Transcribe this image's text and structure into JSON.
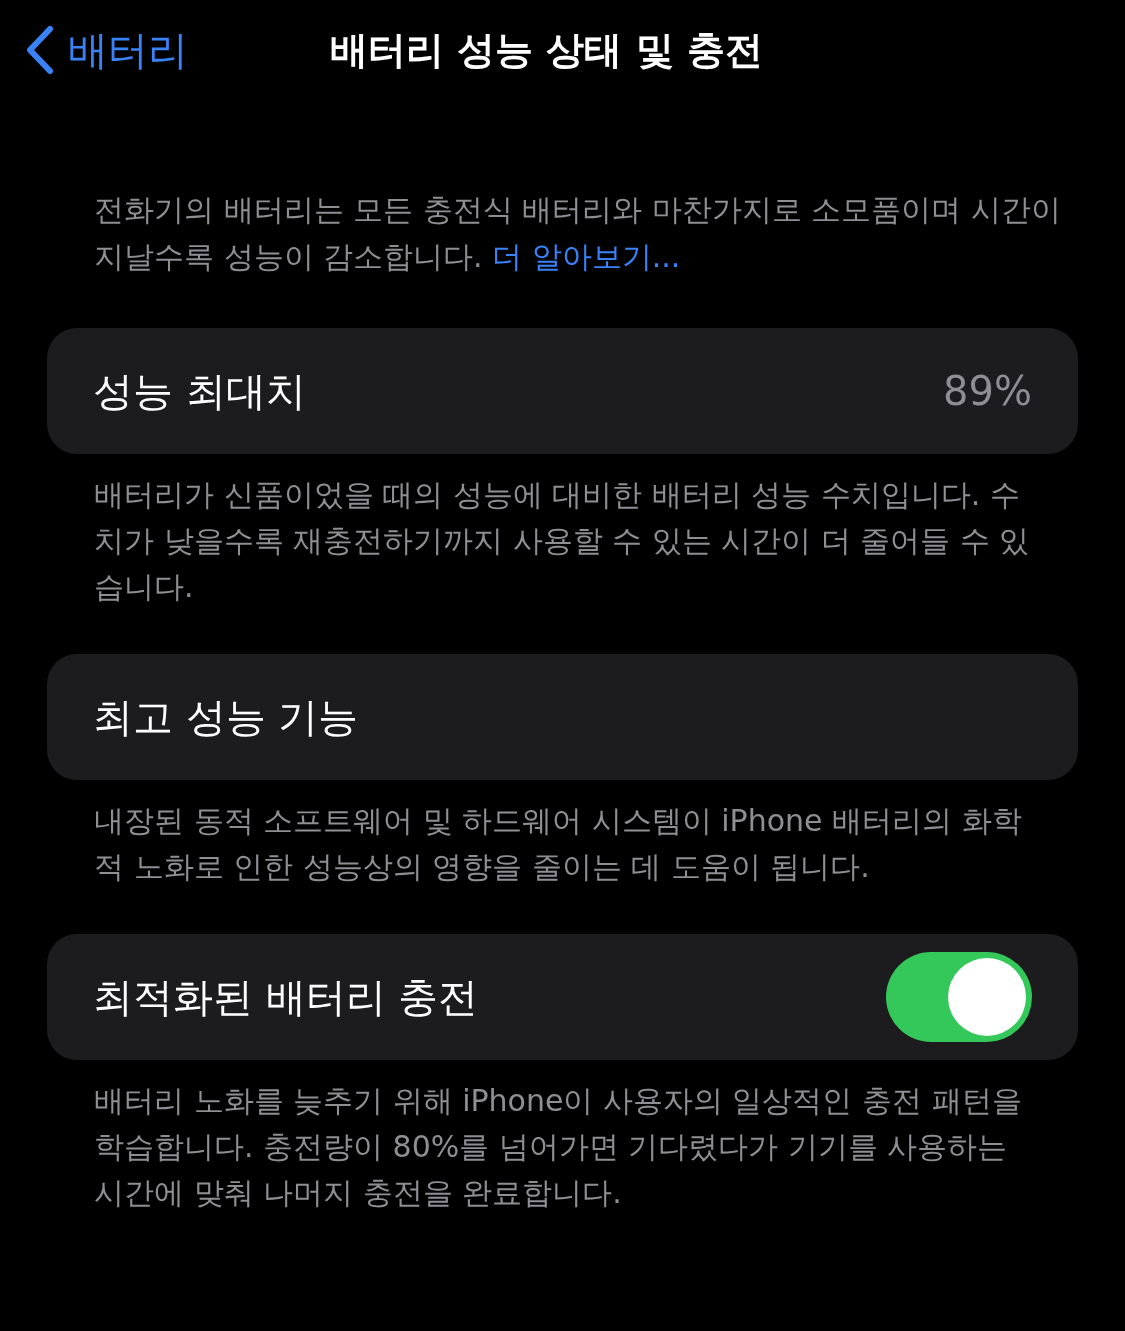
{
  "nav": {
    "back_label": "배터리",
    "title": "배터리 성능 상태 및 충전"
  },
  "intro": {
    "text": "전화기의 배터리는 모든 충전식 배터리와 마찬가지로 소모품이며 시간이 지날수록 성능이 감소합니다.",
    "link": "더 알아보기..."
  },
  "rows": [
    {
      "kind": "value",
      "label": "성능 최대치",
      "value": "89%",
      "footnote": "배터리가 신품이었을 때의 성능에 대비한 배터리 성능 수치입니다. 수치가 낮을수록 재충전하기까지 사용할 수 있는 시간이 더 줄어들 수 있습니다."
    },
    {
      "kind": "plain",
      "label": "최고 성능 기능",
      "footnote": "내장된 동적 소프트웨어 및 하드웨어 시스템이 iPhone 배터리의 화학적 노화로 인한 성능상의 영향을 줄이는 데 도움이 됩니다."
    },
    {
      "kind": "toggle",
      "label": "최적화된 배터리 충전",
      "on": true,
      "footnote": "배터리 노화를 늦추기 위해 iPhone이 사용자의 일상적인 충전 패턴을 학습합니다. 충전량이 80%를 넘어가면 기다렸다가 기기를 사용하는 시간에 맞춰 나머지 충전을 완료합니다."
    }
  ]
}
